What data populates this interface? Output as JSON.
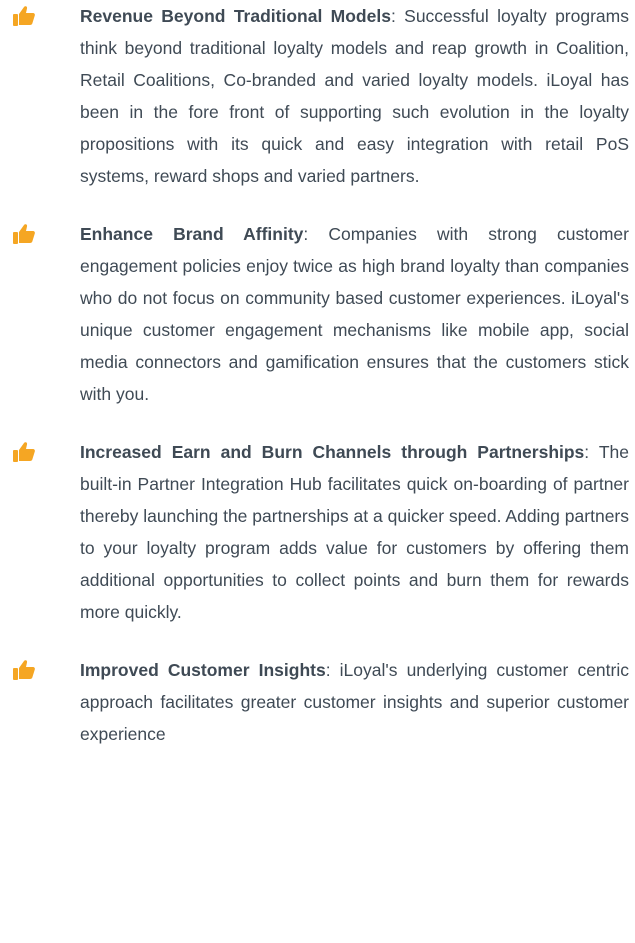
{
  "colors": {
    "icon_orange": "#f5a623",
    "text": "#3f4a55"
  },
  "items": [
    {
      "icon": "thumbs-up-icon",
      "title": "Revenue Beyond Traditional Models",
      "body": ": Successful loyalty programs think beyond traditional loyalty models and reap growth in Coalition, Retail Coalitions, Co-branded and varied loyalty models. iLoyal has been in the fore front of supporting such evolution in the loyalty propositions with its quick and easy integration with retail PoS systems, reward shops and varied partners."
    },
    {
      "icon": "thumbs-up-icon",
      "title": "Enhance Brand Affinity",
      "body": ": Companies with strong customer engagement policies enjoy twice as high brand loyalty than companies who do not focus on community based customer experiences. iLoyal's unique customer engagement mechanisms like mobile app, social media connectors and gamification ensures that the customers stick with you."
    },
    {
      "icon": "thumbs-up-icon",
      "title": "Increased Earn and Burn Channels through Partnerships",
      "body": ": The built-in Partner Integration Hub facilitates quick on-boarding of partner thereby launching the partnerships at a quicker speed. Adding partners to your loyalty program adds value for customers by offering them additional opportunities to collect points and burn them for rewards more quickly."
    },
    {
      "icon": "thumbs-up-icon",
      "title": "Improved Customer Insights",
      "body": ": iLoyal's underlying customer centric approach facilitates greater customer insights and superior customer experience"
    }
  ]
}
